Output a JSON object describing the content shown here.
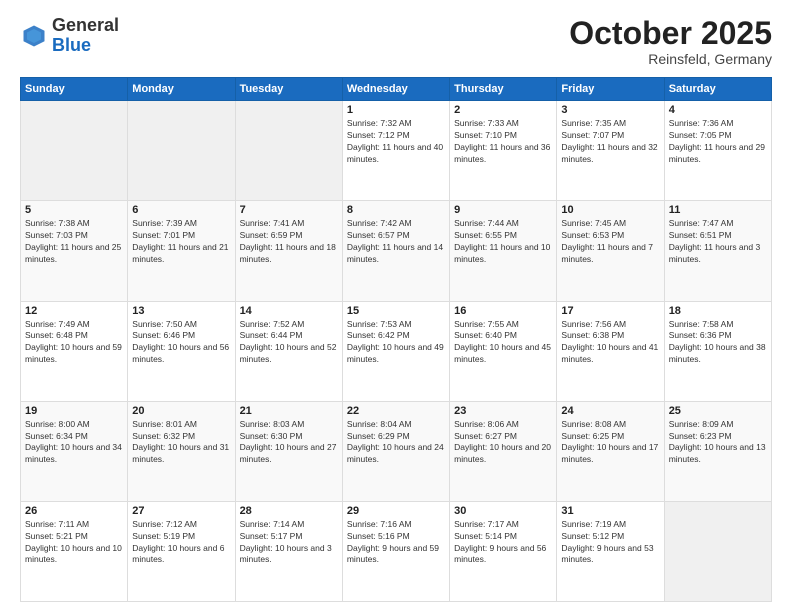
{
  "logo": {
    "general": "General",
    "blue": "Blue"
  },
  "header": {
    "month": "October 2025",
    "location": "Reinsfeld, Germany"
  },
  "weekdays": [
    "Sunday",
    "Monday",
    "Tuesday",
    "Wednesday",
    "Thursday",
    "Friday",
    "Saturday"
  ],
  "weeks": [
    [
      {
        "day": "",
        "sunrise": "",
        "sunset": "",
        "daylight": "",
        "empty": true
      },
      {
        "day": "",
        "sunrise": "",
        "sunset": "",
        "daylight": "",
        "empty": true
      },
      {
        "day": "",
        "sunrise": "",
        "sunset": "",
        "daylight": "",
        "empty": true
      },
      {
        "day": "1",
        "sunrise": "Sunrise: 7:32 AM",
        "sunset": "Sunset: 7:12 PM",
        "daylight": "Daylight: 11 hours and 40 minutes."
      },
      {
        "day": "2",
        "sunrise": "Sunrise: 7:33 AM",
        "sunset": "Sunset: 7:10 PM",
        "daylight": "Daylight: 11 hours and 36 minutes."
      },
      {
        "day": "3",
        "sunrise": "Sunrise: 7:35 AM",
        "sunset": "Sunset: 7:07 PM",
        "daylight": "Daylight: 11 hours and 32 minutes."
      },
      {
        "day": "4",
        "sunrise": "Sunrise: 7:36 AM",
        "sunset": "Sunset: 7:05 PM",
        "daylight": "Daylight: 11 hours and 29 minutes."
      }
    ],
    [
      {
        "day": "5",
        "sunrise": "Sunrise: 7:38 AM",
        "sunset": "Sunset: 7:03 PM",
        "daylight": "Daylight: 11 hours and 25 minutes."
      },
      {
        "day": "6",
        "sunrise": "Sunrise: 7:39 AM",
        "sunset": "Sunset: 7:01 PM",
        "daylight": "Daylight: 11 hours and 21 minutes."
      },
      {
        "day": "7",
        "sunrise": "Sunrise: 7:41 AM",
        "sunset": "Sunset: 6:59 PM",
        "daylight": "Daylight: 11 hours and 18 minutes."
      },
      {
        "day": "8",
        "sunrise": "Sunrise: 7:42 AM",
        "sunset": "Sunset: 6:57 PM",
        "daylight": "Daylight: 11 hours and 14 minutes."
      },
      {
        "day": "9",
        "sunrise": "Sunrise: 7:44 AM",
        "sunset": "Sunset: 6:55 PM",
        "daylight": "Daylight: 11 hours and 10 minutes."
      },
      {
        "day": "10",
        "sunrise": "Sunrise: 7:45 AM",
        "sunset": "Sunset: 6:53 PM",
        "daylight": "Daylight: 11 hours and 7 minutes."
      },
      {
        "day": "11",
        "sunrise": "Sunrise: 7:47 AM",
        "sunset": "Sunset: 6:51 PM",
        "daylight": "Daylight: 11 hours and 3 minutes."
      }
    ],
    [
      {
        "day": "12",
        "sunrise": "Sunrise: 7:49 AM",
        "sunset": "Sunset: 6:48 PM",
        "daylight": "Daylight: 10 hours and 59 minutes."
      },
      {
        "day": "13",
        "sunrise": "Sunrise: 7:50 AM",
        "sunset": "Sunset: 6:46 PM",
        "daylight": "Daylight: 10 hours and 56 minutes."
      },
      {
        "day": "14",
        "sunrise": "Sunrise: 7:52 AM",
        "sunset": "Sunset: 6:44 PM",
        "daylight": "Daylight: 10 hours and 52 minutes."
      },
      {
        "day": "15",
        "sunrise": "Sunrise: 7:53 AM",
        "sunset": "Sunset: 6:42 PM",
        "daylight": "Daylight: 10 hours and 49 minutes."
      },
      {
        "day": "16",
        "sunrise": "Sunrise: 7:55 AM",
        "sunset": "Sunset: 6:40 PM",
        "daylight": "Daylight: 10 hours and 45 minutes."
      },
      {
        "day": "17",
        "sunrise": "Sunrise: 7:56 AM",
        "sunset": "Sunset: 6:38 PM",
        "daylight": "Daylight: 10 hours and 41 minutes."
      },
      {
        "day": "18",
        "sunrise": "Sunrise: 7:58 AM",
        "sunset": "Sunset: 6:36 PM",
        "daylight": "Daylight: 10 hours and 38 minutes."
      }
    ],
    [
      {
        "day": "19",
        "sunrise": "Sunrise: 8:00 AM",
        "sunset": "Sunset: 6:34 PM",
        "daylight": "Daylight: 10 hours and 34 minutes."
      },
      {
        "day": "20",
        "sunrise": "Sunrise: 8:01 AM",
        "sunset": "Sunset: 6:32 PM",
        "daylight": "Daylight: 10 hours and 31 minutes."
      },
      {
        "day": "21",
        "sunrise": "Sunrise: 8:03 AM",
        "sunset": "Sunset: 6:30 PM",
        "daylight": "Daylight: 10 hours and 27 minutes."
      },
      {
        "day": "22",
        "sunrise": "Sunrise: 8:04 AM",
        "sunset": "Sunset: 6:29 PM",
        "daylight": "Daylight: 10 hours and 24 minutes."
      },
      {
        "day": "23",
        "sunrise": "Sunrise: 8:06 AM",
        "sunset": "Sunset: 6:27 PM",
        "daylight": "Daylight: 10 hours and 20 minutes."
      },
      {
        "day": "24",
        "sunrise": "Sunrise: 8:08 AM",
        "sunset": "Sunset: 6:25 PM",
        "daylight": "Daylight: 10 hours and 17 minutes."
      },
      {
        "day": "25",
        "sunrise": "Sunrise: 8:09 AM",
        "sunset": "Sunset: 6:23 PM",
        "daylight": "Daylight: 10 hours and 13 minutes."
      }
    ],
    [
      {
        "day": "26",
        "sunrise": "Sunrise: 7:11 AM",
        "sunset": "Sunset: 5:21 PM",
        "daylight": "Daylight: 10 hours and 10 minutes."
      },
      {
        "day": "27",
        "sunrise": "Sunrise: 7:12 AM",
        "sunset": "Sunset: 5:19 PM",
        "daylight": "Daylight: 10 hours and 6 minutes."
      },
      {
        "day": "28",
        "sunrise": "Sunrise: 7:14 AM",
        "sunset": "Sunset: 5:17 PM",
        "daylight": "Daylight: 10 hours and 3 minutes."
      },
      {
        "day": "29",
        "sunrise": "Sunrise: 7:16 AM",
        "sunset": "Sunset: 5:16 PM",
        "daylight": "Daylight: 9 hours and 59 minutes."
      },
      {
        "day": "30",
        "sunrise": "Sunrise: 7:17 AM",
        "sunset": "Sunset: 5:14 PM",
        "daylight": "Daylight: 9 hours and 56 minutes."
      },
      {
        "day": "31",
        "sunrise": "Sunrise: 7:19 AM",
        "sunset": "Sunset: 5:12 PM",
        "daylight": "Daylight: 9 hours and 53 minutes."
      },
      {
        "day": "",
        "sunrise": "",
        "sunset": "",
        "daylight": "",
        "empty": true
      }
    ]
  ]
}
